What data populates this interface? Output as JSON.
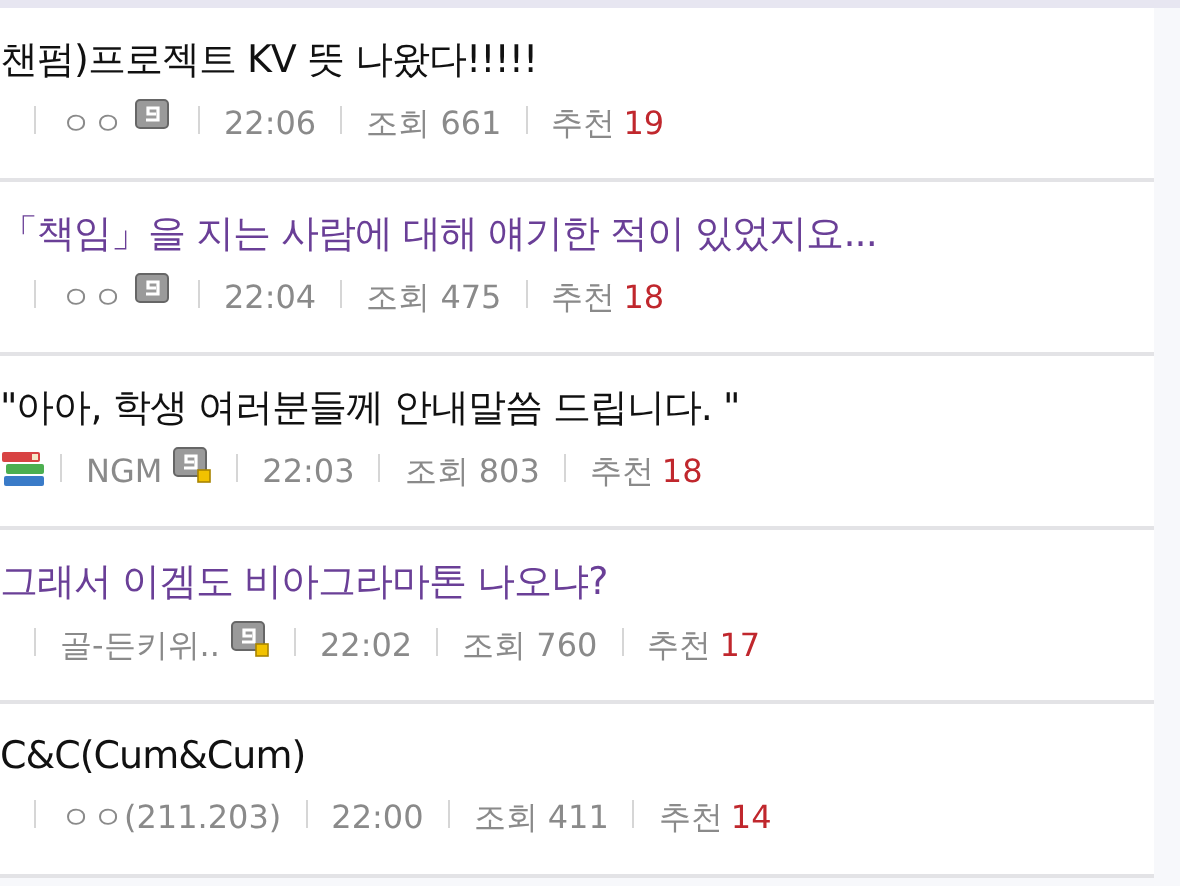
{
  "posts": [
    {
      "title": "챈펌)프로젝트 KV 뜻 나왔다!!!!!",
      "visited": false,
      "books_icon": false,
      "writer": {
        "name": "ㅇㅇ",
        "kind": "fixed"
      },
      "time": "22:06",
      "views": "조회 661",
      "recommend_label": "추천",
      "recommend": "19"
    },
    {
      "title": "「책임」을 지는 사람에 대해 얘기한 적이 있었지요...",
      "visited": true,
      "books_icon": false,
      "writer": {
        "name": "ㅇㅇ",
        "kind": "fixed"
      },
      "time": "22:04",
      "views": "조회 475",
      "recommend_label": "추천",
      "recommend": "18"
    },
    {
      "title": "\"아아, 학생 여러분들께 안내말씀 드립니다. \"",
      "visited": false,
      "books_icon": true,
      "writer": {
        "name": "NGM",
        "kind": "semi"
      },
      "time": "22:03",
      "views": "조회 803",
      "recommend_label": "추천",
      "recommend": "18"
    },
    {
      "title": "그래서 이겜도 비아그라마톤 나오냐?",
      "visited": true,
      "books_icon": false,
      "writer": {
        "name": "골-든키위..",
        "kind": "semi"
      },
      "time": "22:02",
      "views": "조회 760",
      "recommend_label": "추천",
      "recommend": "17"
    },
    {
      "title": "C&C(Cum&Cum)",
      "visited": false,
      "books_icon": false,
      "writer": {
        "name": "ㅇㅇ(211.203)",
        "kind": "ip"
      },
      "time": "22:00",
      "views": "조회 411",
      "recommend_label": "추천",
      "recommend": "14"
    }
  ]
}
